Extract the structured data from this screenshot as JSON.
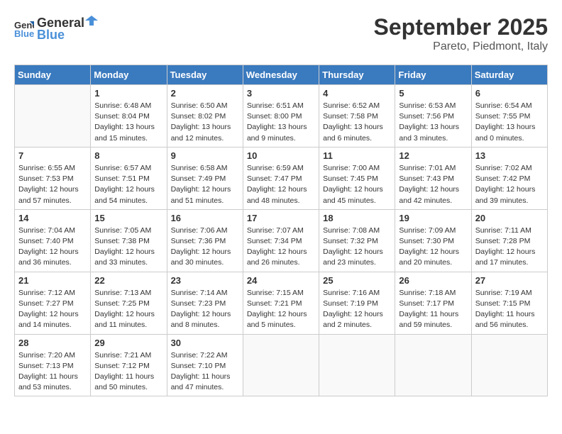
{
  "header": {
    "logo_general": "General",
    "logo_blue": "Blue",
    "month_title": "September 2025",
    "location": "Pareto, Piedmont, Italy"
  },
  "weekdays": [
    "Sunday",
    "Monday",
    "Tuesday",
    "Wednesday",
    "Thursday",
    "Friday",
    "Saturday"
  ],
  "weeks": [
    [
      {
        "day": "",
        "info": ""
      },
      {
        "day": "1",
        "info": "Sunrise: 6:48 AM\nSunset: 8:04 PM\nDaylight: 13 hours\nand 15 minutes."
      },
      {
        "day": "2",
        "info": "Sunrise: 6:50 AM\nSunset: 8:02 PM\nDaylight: 13 hours\nand 12 minutes."
      },
      {
        "day": "3",
        "info": "Sunrise: 6:51 AM\nSunset: 8:00 PM\nDaylight: 13 hours\nand 9 minutes."
      },
      {
        "day": "4",
        "info": "Sunrise: 6:52 AM\nSunset: 7:58 PM\nDaylight: 13 hours\nand 6 minutes."
      },
      {
        "day": "5",
        "info": "Sunrise: 6:53 AM\nSunset: 7:56 PM\nDaylight: 13 hours\nand 3 minutes."
      },
      {
        "day": "6",
        "info": "Sunrise: 6:54 AM\nSunset: 7:55 PM\nDaylight: 13 hours\nand 0 minutes."
      }
    ],
    [
      {
        "day": "7",
        "info": "Sunrise: 6:55 AM\nSunset: 7:53 PM\nDaylight: 12 hours\nand 57 minutes."
      },
      {
        "day": "8",
        "info": "Sunrise: 6:57 AM\nSunset: 7:51 PM\nDaylight: 12 hours\nand 54 minutes."
      },
      {
        "day": "9",
        "info": "Sunrise: 6:58 AM\nSunset: 7:49 PM\nDaylight: 12 hours\nand 51 minutes."
      },
      {
        "day": "10",
        "info": "Sunrise: 6:59 AM\nSunset: 7:47 PM\nDaylight: 12 hours\nand 48 minutes."
      },
      {
        "day": "11",
        "info": "Sunrise: 7:00 AM\nSunset: 7:45 PM\nDaylight: 12 hours\nand 45 minutes."
      },
      {
        "day": "12",
        "info": "Sunrise: 7:01 AM\nSunset: 7:43 PM\nDaylight: 12 hours\nand 42 minutes."
      },
      {
        "day": "13",
        "info": "Sunrise: 7:02 AM\nSunset: 7:42 PM\nDaylight: 12 hours\nand 39 minutes."
      }
    ],
    [
      {
        "day": "14",
        "info": "Sunrise: 7:04 AM\nSunset: 7:40 PM\nDaylight: 12 hours\nand 36 minutes."
      },
      {
        "day": "15",
        "info": "Sunrise: 7:05 AM\nSunset: 7:38 PM\nDaylight: 12 hours\nand 33 minutes."
      },
      {
        "day": "16",
        "info": "Sunrise: 7:06 AM\nSunset: 7:36 PM\nDaylight: 12 hours\nand 30 minutes."
      },
      {
        "day": "17",
        "info": "Sunrise: 7:07 AM\nSunset: 7:34 PM\nDaylight: 12 hours\nand 26 minutes."
      },
      {
        "day": "18",
        "info": "Sunrise: 7:08 AM\nSunset: 7:32 PM\nDaylight: 12 hours\nand 23 minutes."
      },
      {
        "day": "19",
        "info": "Sunrise: 7:09 AM\nSunset: 7:30 PM\nDaylight: 12 hours\nand 20 minutes."
      },
      {
        "day": "20",
        "info": "Sunrise: 7:11 AM\nSunset: 7:28 PM\nDaylight: 12 hours\nand 17 minutes."
      }
    ],
    [
      {
        "day": "21",
        "info": "Sunrise: 7:12 AM\nSunset: 7:27 PM\nDaylight: 12 hours\nand 14 minutes."
      },
      {
        "day": "22",
        "info": "Sunrise: 7:13 AM\nSunset: 7:25 PM\nDaylight: 12 hours\nand 11 minutes."
      },
      {
        "day": "23",
        "info": "Sunrise: 7:14 AM\nSunset: 7:23 PM\nDaylight: 12 hours\nand 8 minutes."
      },
      {
        "day": "24",
        "info": "Sunrise: 7:15 AM\nSunset: 7:21 PM\nDaylight: 12 hours\nand 5 minutes."
      },
      {
        "day": "25",
        "info": "Sunrise: 7:16 AM\nSunset: 7:19 PM\nDaylight: 12 hours\nand 2 minutes."
      },
      {
        "day": "26",
        "info": "Sunrise: 7:18 AM\nSunset: 7:17 PM\nDaylight: 11 hours\nand 59 minutes."
      },
      {
        "day": "27",
        "info": "Sunrise: 7:19 AM\nSunset: 7:15 PM\nDaylight: 11 hours\nand 56 minutes."
      }
    ],
    [
      {
        "day": "28",
        "info": "Sunrise: 7:20 AM\nSunset: 7:13 PM\nDaylight: 11 hours\nand 53 minutes."
      },
      {
        "day": "29",
        "info": "Sunrise: 7:21 AM\nSunset: 7:12 PM\nDaylight: 11 hours\nand 50 minutes."
      },
      {
        "day": "30",
        "info": "Sunrise: 7:22 AM\nSunset: 7:10 PM\nDaylight: 11 hours\nand 47 minutes."
      },
      {
        "day": "",
        "info": ""
      },
      {
        "day": "",
        "info": ""
      },
      {
        "day": "",
        "info": ""
      },
      {
        "day": "",
        "info": ""
      }
    ]
  ]
}
